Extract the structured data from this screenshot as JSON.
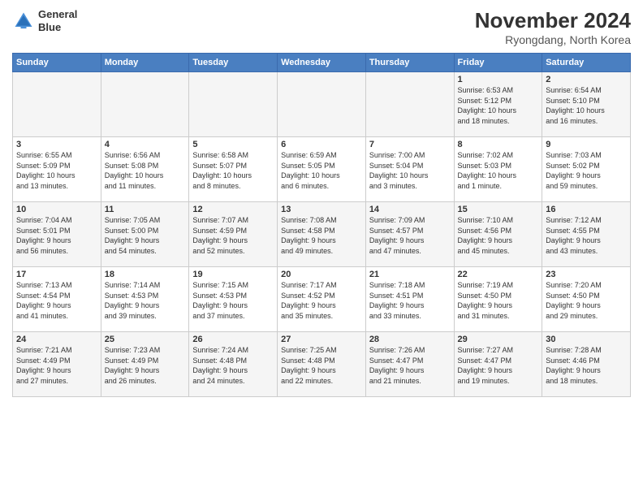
{
  "logo": {
    "line1": "General",
    "line2": "Blue"
  },
  "title": "November 2024",
  "subtitle": "Ryongdang, North Korea",
  "days_header": [
    "Sunday",
    "Monday",
    "Tuesday",
    "Wednesday",
    "Thursday",
    "Friday",
    "Saturday"
  ],
  "weeks": [
    {
      "days": [
        {
          "num": "",
          "info": ""
        },
        {
          "num": "",
          "info": ""
        },
        {
          "num": "",
          "info": ""
        },
        {
          "num": "",
          "info": ""
        },
        {
          "num": "",
          "info": ""
        },
        {
          "num": "1",
          "info": "Sunrise: 6:53 AM\nSunset: 5:12 PM\nDaylight: 10 hours\nand 18 minutes."
        },
        {
          "num": "2",
          "info": "Sunrise: 6:54 AM\nSunset: 5:10 PM\nDaylight: 10 hours\nand 16 minutes."
        }
      ]
    },
    {
      "days": [
        {
          "num": "3",
          "info": "Sunrise: 6:55 AM\nSunset: 5:09 PM\nDaylight: 10 hours\nand 13 minutes."
        },
        {
          "num": "4",
          "info": "Sunrise: 6:56 AM\nSunset: 5:08 PM\nDaylight: 10 hours\nand 11 minutes."
        },
        {
          "num": "5",
          "info": "Sunrise: 6:58 AM\nSunset: 5:07 PM\nDaylight: 10 hours\nand 8 minutes."
        },
        {
          "num": "6",
          "info": "Sunrise: 6:59 AM\nSunset: 5:05 PM\nDaylight: 10 hours\nand 6 minutes."
        },
        {
          "num": "7",
          "info": "Sunrise: 7:00 AM\nSunset: 5:04 PM\nDaylight: 10 hours\nand 3 minutes."
        },
        {
          "num": "8",
          "info": "Sunrise: 7:02 AM\nSunset: 5:03 PM\nDaylight: 10 hours\nand 1 minute."
        },
        {
          "num": "9",
          "info": "Sunrise: 7:03 AM\nSunset: 5:02 PM\nDaylight: 9 hours\nand 59 minutes."
        }
      ]
    },
    {
      "days": [
        {
          "num": "10",
          "info": "Sunrise: 7:04 AM\nSunset: 5:01 PM\nDaylight: 9 hours\nand 56 minutes."
        },
        {
          "num": "11",
          "info": "Sunrise: 7:05 AM\nSunset: 5:00 PM\nDaylight: 9 hours\nand 54 minutes."
        },
        {
          "num": "12",
          "info": "Sunrise: 7:07 AM\nSunset: 4:59 PM\nDaylight: 9 hours\nand 52 minutes."
        },
        {
          "num": "13",
          "info": "Sunrise: 7:08 AM\nSunset: 4:58 PM\nDaylight: 9 hours\nand 49 minutes."
        },
        {
          "num": "14",
          "info": "Sunrise: 7:09 AM\nSunset: 4:57 PM\nDaylight: 9 hours\nand 47 minutes."
        },
        {
          "num": "15",
          "info": "Sunrise: 7:10 AM\nSunset: 4:56 PM\nDaylight: 9 hours\nand 45 minutes."
        },
        {
          "num": "16",
          "info": "Sunrise: 7:12 AM\nSunset: 4:55 PM\nDaylight: 9 hours\nand 43 minutes."
        }
      ]
    },
    {
      "days": [
        {
          "num": "17",
          "info": "Sunrise: 7:13 AM\nSunset: 4:54 PM\nDaylight: 9 hours\nand 41 minutes."
        },
        {
          "num": "18",
          "info": "Sunrise: 7:14 AM\nSunset: 4:53 PM\nDaylight: 9 hours\nand 39 minutes."
        },
        {
          "num": "19",
          "info": "Sunrise: 7:15 AM\nSunset: 4:53 PM\nDaylight: 9 hours\nand 37 minutes."
        },
        {
          "num": "20",
          "info": "Sunrise: 7:17 AM\nSunset: 4:52 PM\nDaylight: 9 hours\nand 35 minutes."
        },
        {
          "num": "21",
          "info": "Sunrise: 7:18 AM\nSunset: 4:51 PM\nDaylight: 9 hours\nand 33 minutes."
        },
        {
          "num": "22",
          "info": "Sunrise: 7:19 AM\nSunset: 4:50 PM\nDaylight: 9 hours\nand 31 minutes."
        },
        {
          "num": "23",
          "info": "Sunrise: 7:20 AM\nSunset: 4:50 PM\nDaylight: 9 hours\nand 29 minutes."
        }
      ]
    },
    {
      "days": [
        {
          "num": "24",
          "info": "Sunrise: 7:21 AM\nSunset: 4:49 PM\nDaylight: 9 hours\nand 27 minutes."
        },
        {
          "num": "25",
          "info": "Sunrise: 7:23 AM\nSunset: 4:49 PM\nDaylight: 9 hours\nand 26 minutes."
        },
        {
          "num": "26",
          "info": "Sunrise: 7:24 AM\nSunset: 4:48 PM\nDaylight: 9 hours\nand 24 minutes."
        },
        {
          "num": "27",
          "info": "Sunrise: 7:25 AM\nSunset: 4:48 PM\nDaylight: 9 hours\nand 22 minutes."
        },
        {
          "num": "28",
          "info": "Sunrise: 7:26 AM\nSunset: 4:47 PM\nDaylight: 9 hours\nand 21 minutes."
        },
        {
          "num": "29",
          "info": "Sunrise: 7:27 AM\nSunset: 4:47 PM\nDaylight: 9 hours\nand 19 minutes."
        },
        {
          "num": "30",
          "info": "Sunrise: 7:28 AM\nSunset: 4:46 PM\nDaylight: 9 hours\nand 18 minutes."
        }
      ]
    }
  ]
}
